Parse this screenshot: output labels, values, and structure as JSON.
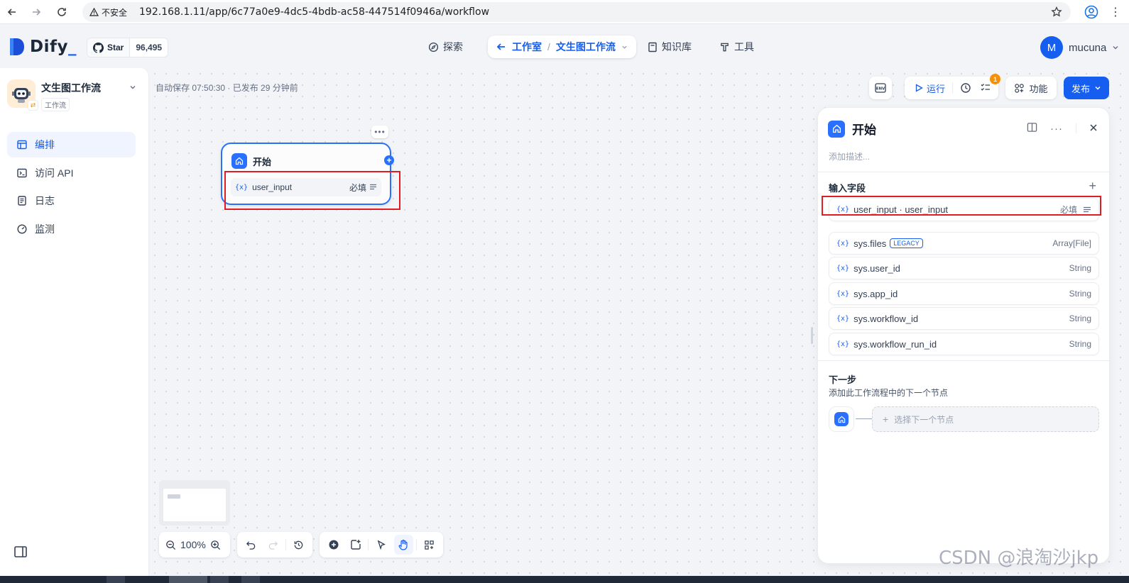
{
  "browser": {
    "security_label": "不安全",
    "url": "192.168.1.11/app/6c77a0e9-4dc5-4bdb-ac58-447514f0946a/workflow"
  },
  "header": {
    "logo_text": "Dify",
    "github": {
      "label": "Star",
      "count": "96,495"
    },
    "nav": {
      "explore": "探索",
      "studio": "工作室",
      "current_app": "文生图工作流",
      "knowledge": "知识库",
      "tools": "工具"
    },
    "user": {
      "initial": "M",
      "name": "mucuna"
    }
  },
  "sidebar": {
    "app_name": "文生图工作流",
    "app_type": "工作流",
    "items": [
      {
        "label": "编排",
        "icon": "layout-icon",
        "active": true
      },
      {
        "label": "访问 API",
        "icon": "terminal-icon",
        "active": false
      },
      {
        "label": "日志",
        "icon": "file-list-icon",
        "active": false
      },
      {
        "label": "监测",
        "icon": "gauge-icon",
        "active": false
      }
    ]
  },
  "canvas": {
    "autosave": "自动保存 07:50:30 · 已发布 29 分钟前",
    "toolbar": {
      "env": "ENV",
      "run": "运行",
      "features": "功能",
      "publish": "发布",
      "checklist_count": "1"
    },
    "start_node": {
      "title": "开始",
      "var_icon": "{x}",
      "field": "user_input",
      "required": "必填"
    },
    "zoom": "100%"
  },
  "panel": {
    "title": "开始",
    "description_placeholder": "添加描述...",
    "input_section": "输入字段",
    "input_var": {
      "name": "user_input · user_input",
      "required": "必填"
    },
    "sys_vars": [
      {
        "name": "sys.files",
        "badge": "LEGACY",
        "type": "Array[File]"
      },
      {
        "name": "sys.user_id",
        "type": "String"
      },
      {
        "name": "sys.app_id",
        "type": "String"
      },
      {
        "name": "sys.workflow_id",
        "type": "String"
      },
      {
        "name": "sys.workflow_run_id",
        "type": "String"
      }
    ],
    "next_step": {
      "title": "下一步",
      "description": "添加此工作流程中的下一个节点",
      "select_label": "选择下一个节点"
    }
  },
  "watermark": "CSDN @浪淘沙jkp",
  "colors": {
    "primary": "#155eef",
    "node_accent": "#2970ff",
    "highlight_box": "#e11d24",
    "badge": "#f79009"
  }
}
